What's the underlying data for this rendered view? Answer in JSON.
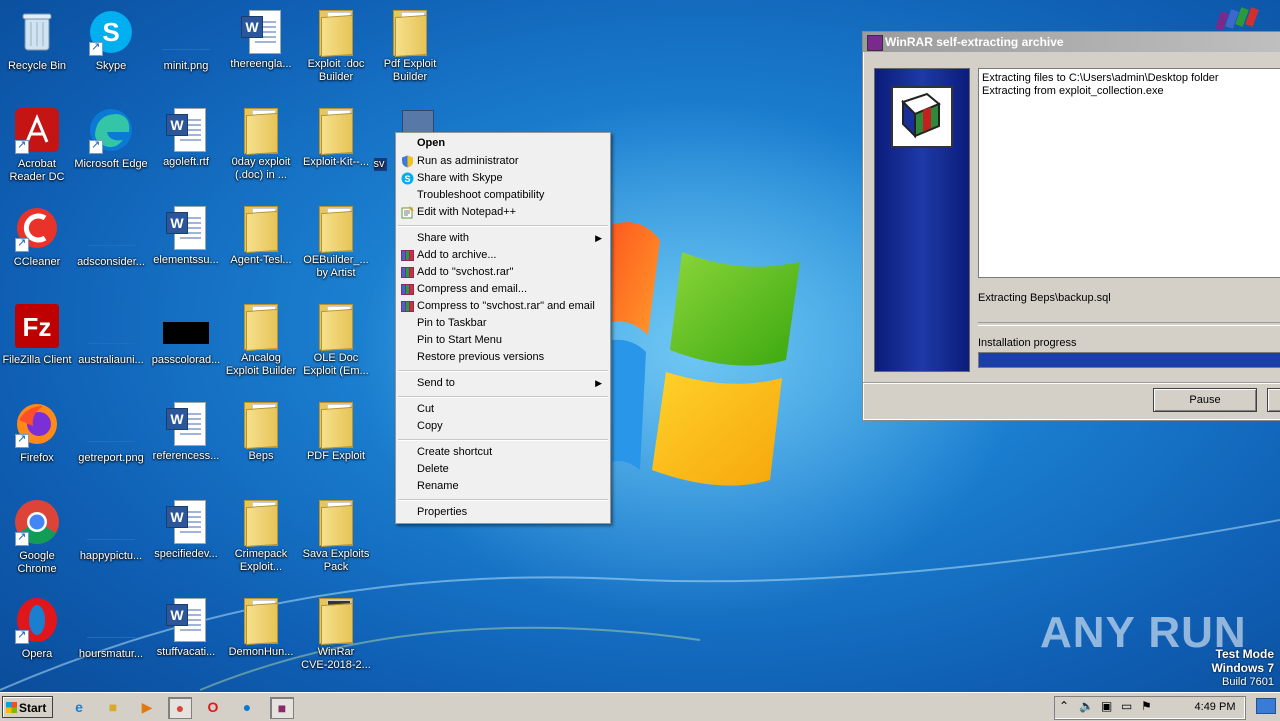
{
  "desktop": {
    "icons": [
      {
        "label": "Recycle Bin"
      },
      {
        "label": "Skype"
      },
      {
        "label": "minit.png"
      },
      {
        "label": "thereengla..."
      },
      {
        "label": "Exploit .doc\nBuilder"
      },
      {
        "label": "Pdf Exploit\nBuilder"
      },
      {
        "label": "Acrobat\nReader DC"
      },
      {
        "label": "Microsoft Edge"
      },
      {
        "label": "agoleft.rtf"
      },
      {
        "label": "0day exploit\n(.doc) in ..."
      },
      {
        "label": "Exploit-Kit--..."
      },
      {
        "label": "sv"
      },
      {
        "label": "CCleaner"
      },
      {
        "label": "adsconsider..."
      },
      {
        "label": "elementssu..."
      },
      {
        "label": "Agent-Tesl..."
      },
      {
        "label": "OEBuilder_...\nby Artist"
      },
      {
        "label": "FileZilla Client"
      },
      {
        "label": "australiauni..."
      },
      {
        "label": "passcolorad..."
      },
      {
        "label": "Ancalog\nExploit Builder"
      },
      {
        "label": "OLE Doc\nExploit (Em..."
      },
      {
        "label": "Firefox"
      },
      {
        "label": "getreport.png"
      },
      {
        "label": "referencess..."
      },
      {
        "label": "Beps"
      },
      {
        "label": "PDF Exploit"
      },
      {
        "label": "Google\nChrome"
      },
      {
        "label": "happypictu..."
      },
      {
        "label": "specifiedev..."
      },
      {
        "label": "Crimepack\nExploit..."
      },
      {
        "label": "Sava Exploits\nPack"
      },
      {
        "label": "Opera"
      },
      {
        "label": "hoursmatur..."
      },
      {
        "label": "stuffvacati..."
      },
      {
        "label": "DemonHun..."
      },
      {
        "label": "WinRar\nCVE-2018-2..."
      }
    ]
  },
  "context_menu": {
    "items": [
      {
        "label": "Open"
      },
      {
        "label": "Run as administrator"
      },
      {
        "label": "Share with Skype"
      },
      {
        "label": "Troubleshoot compatibility"
      },
      {
        "label": "Edit with Notepad++"
      },
      {
        "label": "Share with"
      },
      {
        "label": "Add to archive..."
      },
      {
        "label": "Add to \"svchost.rar\""
      },
      {
        "label": "Compress and email..."
      },
      {
        "label": "Compress to \"svchost.rar\" and email"
      },
      {
        "label": "Pin to Taskbar"
      },
      {
        "label": "Pin to Start Menu"
      },
      {
        "label": "Restore previous versions"
      },
      {
        "label": "Send to"
      },
      {
        "label": "Cut"
      },
      {
        "label": "Copy"
      },
      {
        "label": "Create shortcut"
      },
      {
        "label": "Delete"
      },
      {
        "label": "Rename"
      },
      {
        "label": "Properties"
      }
    ]
  },
  "winrar": {
    "title": "WinRAR self-extracting archive",
    "log_lines": [
      "Extracting files to C:\\Users\\admin\\Desktop folder",
      "Extracting from exploit_collection.exe"
    ],
    "status": "Extracting Beps\\backup.sql",
    "progress_label": "Installation progress",
    "progress": 1.0,
    "pause_label": "Pause"
  },
  "watermark": {
    "brand": "ANY RUN",
    "mode_line1": "Test Mode",
    "mode_line2": "Windows 7",
    "build": "Build 7601"
  },
  "taskbar": {
    "start_label": "Start",
    "clock": "4:49 PM"
  }
}
